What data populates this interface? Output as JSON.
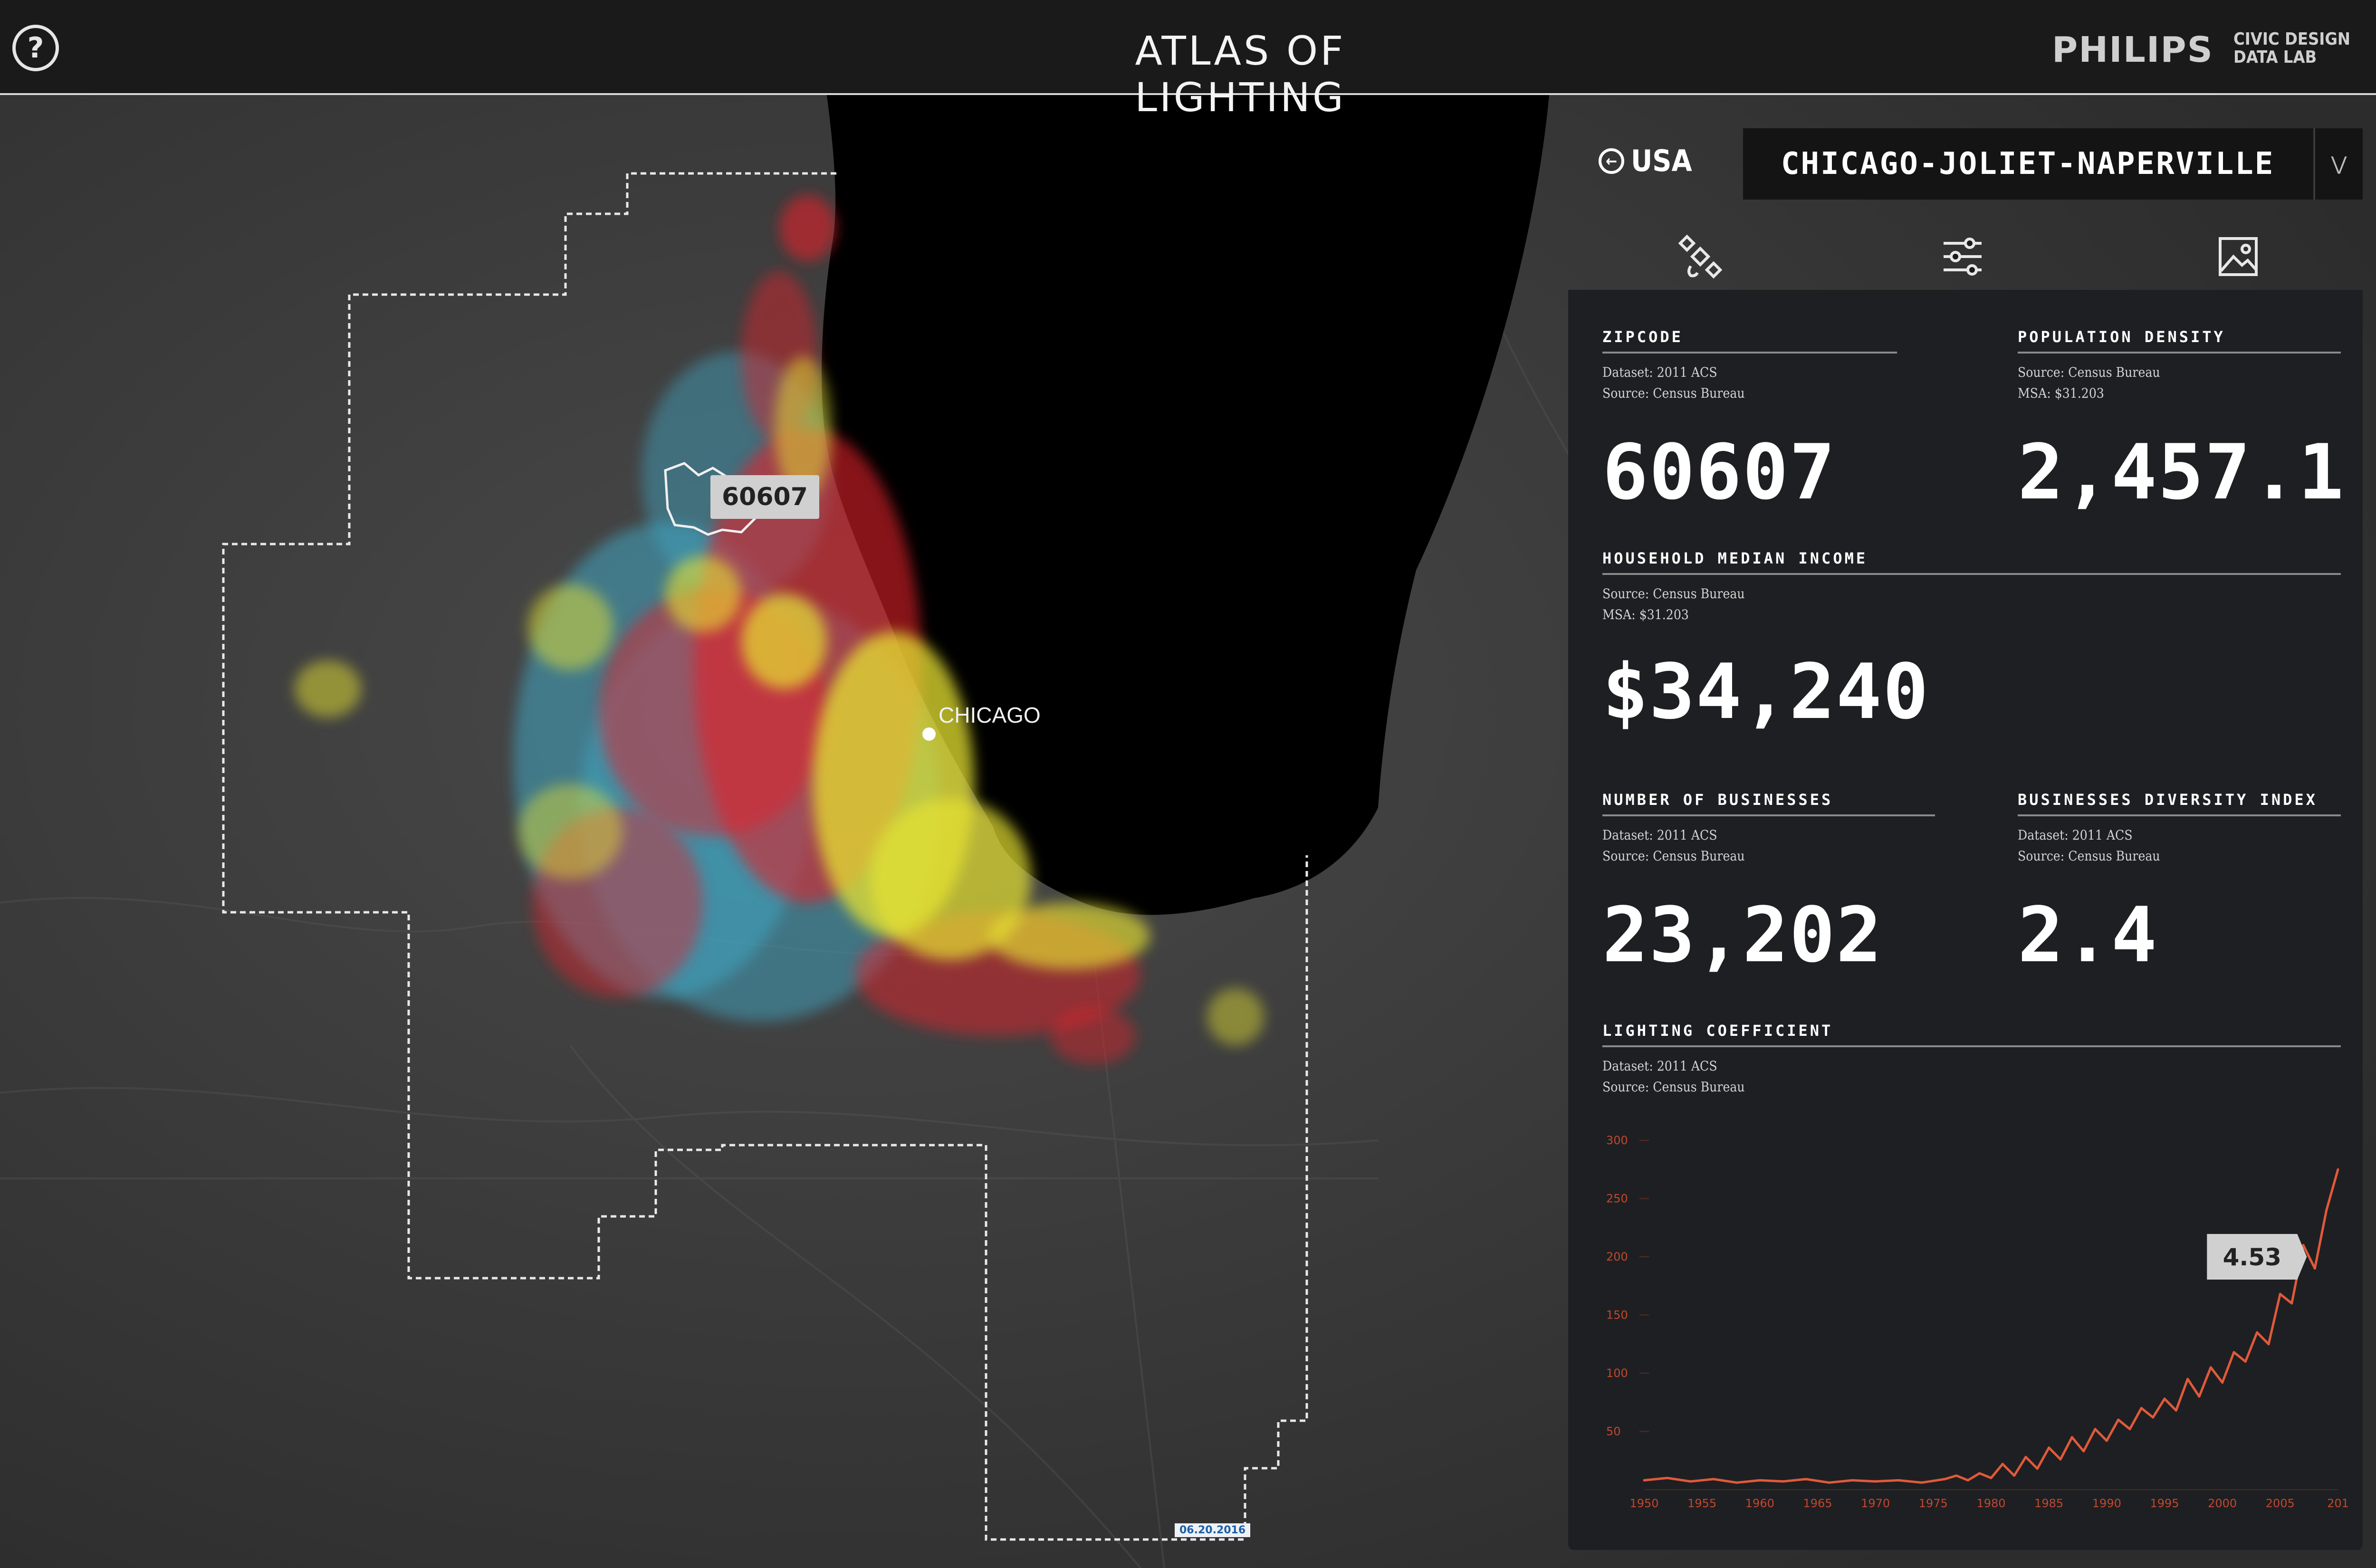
{
  "header": {
    "help_label": "?",
    "title": "ATLAS OF LIGHTING",
    "brand": "PHILIPS",
    "partner_line1": "CIVIC DESIGN",
    "partner_line2": "DATA LAB"
  },
  "map": {
    "zipcode_label": "60607",
    "city_label": "CHICAGO",
    "date_stamp": "06.20.2016",
    "colors": {
      "land": "#3a3a3a",
      "lake": "#000000",
      "blue": "#3fa6c3",
      "red": "#e0202a",
      "yellow": "#e6e230",
      "boundary": "#e8e8e8"
    }
  },
  "panel": {
    "back_label": "USA",
    "metro_name": "CHICAGO-JOLIET-NAPERVILLE",
    "tabs": [
      {
        "name": "satellite-icon"
      },
      {
        "name": "sliders-icon"
      },
      {
        "name": "image-icon"
      }
    ],
    "metrics": {
      "zipcode": {
        "label": "ZIPCODE",
        "source": "Dataset: 2011 ACS\nSource: Census Bureau",
        "value": "60607"
      },
      "population_density": {
        "label": "POPULATION DENSITY",
        "source": "Source: Census Bureau\nMSA: $31.203",
        "value": "2,457.1"
      },
      "household_income": {
        "label": "HOUSEHOLD MEDIAN INCOME",
        "source": "Source: Census Bureau\nMSA: $31.203",
        "value": "$34,240"
      },
      "businesses": {
        "label": "NUMBER OF BUSINESSES",
        "source": "Dataset: 2011 ACS\nSource: Census Bureau",
        "value": "23,202"
      },
      "diversity": {
        "label": "BUSINESSES DIVERSITY INDEX",
        "source": "Dataset: 2011 ACS\nSource: Census Bureau",
        "value": "2.4"
      },
      "lighting": {
        "label": "LIGHTING COEFFICIENT",
        "source": "Dataset: 2011 ACS\nSource: Census Bureau"
      }
    }
  },
  "chart_data": {
    "type": "line",
    "callout": "4.53",
    "color": "#e05a3a",
    "x_ticks": [
      "1950",
      "1955",
      "1960",
      "1965",
      "1970",
      "1975",
      "1980",
      "1985",
      "1990",
      "1995",
      "2000",
      "2005",
      "201"
    ],
    "y_ticks": [
      "300",
      "250",
      "200",
      "150",
      "100",
      "50"
    ],
    "ylim": [
      0,
      300
    ],
    "xlim": [
      1950,
      2010
    ],
    "x": [
      1950,
      1952,
      1954,
      1956,
      1958,
      1960,
      1962,
      1964,
      1966,
      1968,
      1970,
      1972,
      1974,
      1976,
      1977,
      1978,
      1979,
      1980,
      1981,
      1982,
      1983,
      1984,
      1985,
      1986,
      1987,
      1988,
      1989,
      1990,
      1991,
      1992,
      1993,
      1994,
      1995,
      1996,
      1997,
      1998,
      1999,
      2000,
      2001,
      2002,
      2003,
      2004,
      2005,
      2006,
      2007,
      2008,
      2009,
      2010
    ],
    "y": [
      8,
      10,
      7,
      9,
      6,
      8,
      7,
      9,
      6,
      8,
      7,
      8,
      6,
      9,
      12,
      8,
      14,
      10,
      22,
      12,
      28,
      18,
      36,
      26,
      45,
      33,
      52,
      42,
      60,
      52,
      70,
      62,
      78,
      68,
      95,
      80,
      105,
      92,
      118,
      110,
      135,
      125,
      168,
      160,
      210,
      190,
      240,
      275
    ]
  }
}
